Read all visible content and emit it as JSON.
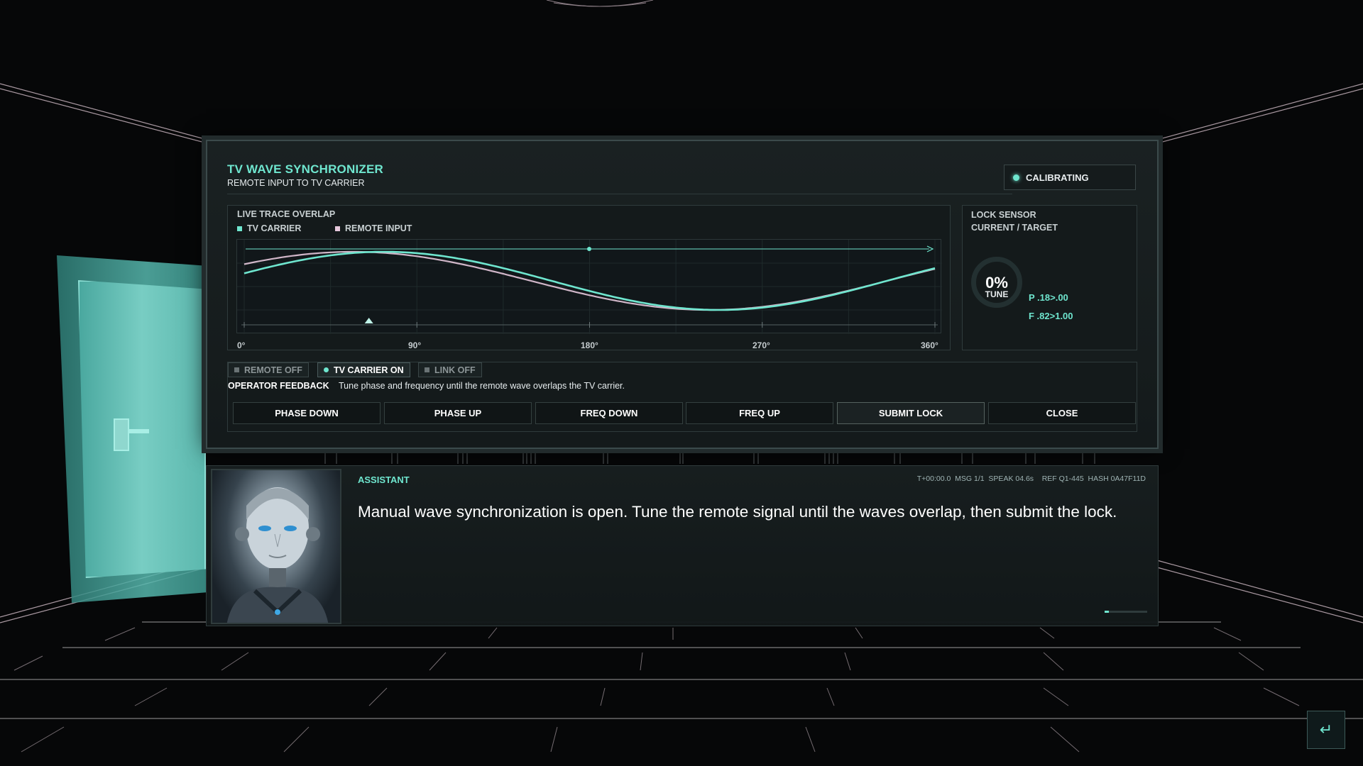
{
  "panel": {
    "title": "TV WAVE SYNCHRONIZER",
    "subtitle": "REMOTE INPUT TO TV CARRIER",
    "status": "CALIBRATING",
    "accent_color": "#6fe6cf",
    "remote_color": "#e6c8dc"
  },
  "trace": {
    "title": "LIVE TRACE OVERLAP",
    "legend": [
      {
        "label": "TV CARRIER",
        "color": "#6fe6cf"
      },
      {
        "label": "REMOTE INPUT",
        "color": "#e6c8dc"
      }
    ],
    "ticks": [
      "0°",
      "90°",
      "180°",
      "270°",
      "360°"
    ],
    "marker_phase_deg": 65
  },
  "sensor": {
    "title": "LOCK SENSOR",
    "subtitle": "CURRENT / TARGET",
    "percent": "0%",
    "percent_label": "TUNE",
    "phase_readout": "P .18>.00",
    "freq_readout": "F .82>1.00"
  },
  "controls": {
    "toggles": [
      {
        "label": "REMOTE OFF",
        "state": "off"
      },
      {
        "label": "TV CARRIER ON",
        "state": "on"
      },
      {
        "label": "LINK OFF",
        "state": "off"
      }
    ],
    "feedback_label": "OPERATOR FEEDBACK",
    "feedback_text": "Tune phase and frequency until the remote wave overlaps the TV carrier.",
    "buttons": [
      "PHASE DOWN",
      "PHASE UP",
      "FREQ DOWN",
      "FREQ UP",
      "SUBMIT LOCK",
      "CLOSE"
    ]
  },
  "dialog": {
    "speaker": "ASSISTANT",
    "meta": "T+00:00.0  MSG 1/1  SPEAK 04.6s    REF Q1-445  HASH 0A47F11D",
    "message": "Manual wave synchronization is open. Tune the remote signal until the waves overlap, then submit the lock.",
    "progress": 0.1
  },
  "icons": {
    "enter": "enter-icon",
    "portrait": "android-portrait"
  }
}
